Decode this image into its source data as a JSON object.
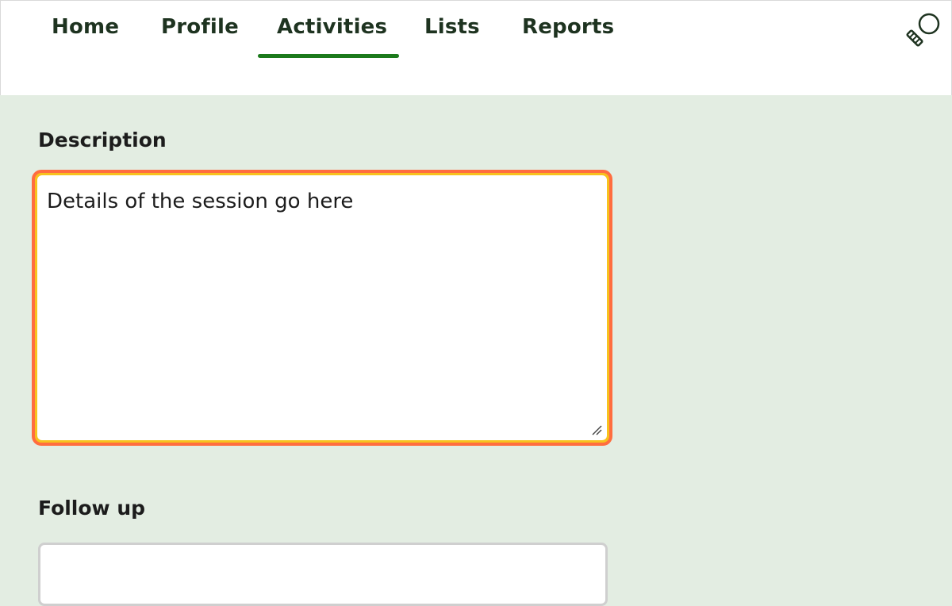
{
  "nav": {
    "items": [
      {
        "label": "Home"
      },
      {
        "label": "Profile"
      },
      {
        "label": "Activities"
      },
      {
        "label": "Lists"
      },
      {
        "label": "Reports"
      }
    ],
    "active": "Activities",
    "search_icon": "search-icon"
  },
  "form": {
    "description": {
      "label": "Description",
      "value": "Details of the session go here"
    },
    "follow_up": {
      "label": "Follow up",
      "value": ""
    }
  },
  "colors": {
    "accent": "#1c7a1c",
    "focus_ring_outer": "#ff6d3f",
    "focus_ring_inner": "#f7c21e",
    "page_background": "#e3ede2"
  }
}
